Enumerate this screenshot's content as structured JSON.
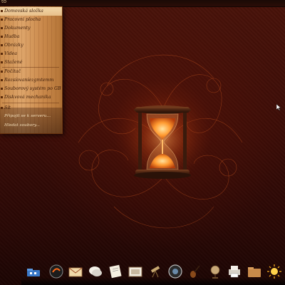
{
  "topbar": {
    "label": "to"
  },
  "menu": {
    "items": [
      {
        "label": "Domovská složka",
        "selected": true
      },
      {
        "label": "Pracovní plocha"
      },
      {
        "label": "Dokumenty"
      },
      {
        "label": "Hudba"
      },
      {
        "label": "Obrázky"
      },
      {
        "label": "Videa"
      },
      {
        "label": "Stažené"
      },
      {
        "label": "Počítač"
      },
      {
        "label": "Rozsíovaníezgmtemm"
      },
      {
        "label": "Souborový systém po GB"
      },
      {
        "label": "Diskvová mechanika"
      },
      {
        "label": "Sít"
      }
    ],
    "sub_items": [
      {
        "label": "Připojit se k serveru..."
      },
      {
        "label": "Hledat soubory..."
      }
    ]
  },
  "dock": {
    "icons": [
      "folder-network-icon",
      "browser-icon",
      "mail-icon",
      "chat-icon",
      "notes-icon",
      "presentation-icon",
      "telescope-icon",
      "camera-icon",
      "guitar-icon",
      "globe-icon",
      "printer-icon",
      "folder-icon",
      "sun-icon"
    ]
  },
  "colors": {
    "background": "#3a0b06",
    "menu_wood": "#d89c5f",
    "menu_text": "#3a1a08",
    "accent_glow": "#ff8a2a"
  }
}
